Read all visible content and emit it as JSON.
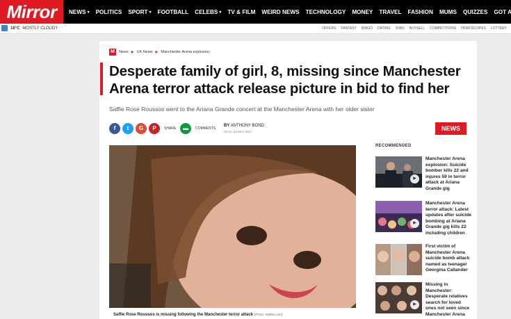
{
  "brand": {
    "logo": "Mirror",
    "accent": "#e01a22"
  },
  "nav": [
    {
      "label": "NEWS",
      "caret": "▾"
    },
    {
      "label": "POLITICS",
      "caret": ""
    },
    {
      "label": "SPORT",
      "caret": "▾"
    },
    {
      "label": "FOOTBALL",
      "caret": ""
    },
    {
      "label": "CELEBS",
      "caret": "▾"
    },
    {
      "label": "TV & FILM",
      "caret": ""
    },
    {
      "label": "WEIRD NEWS",
      "caret": ""
    },
    {
      "label": "TECHNOLOGY",
      "caret": ""
    },
    {
      "label": "MONEY",
      "caret": ""
    },
    {
      "label": "TRAVEL",
      "caret": ""
    },
    {
      "label": "FASHION",
      "caret": ""
    },
    {
      "label": "MUMS",
      "caret": ""
    },
    {
      "label": "QUIZZES",
      "caret": ""
    },
    {
      "label": "GOT A STORY?",
      "caret": ""
    }
  ],
  "weather": {
    "temp": "18°C",
    "condition": "MOSTLY CLOUDY",
    "icon": "weather-icon"
  },
  "sublinks": [
    "OFFERS",
    "FANTASY",
    "BINGO",
    "DATING",
    "JOBS",
    "BUYSELL",
    "COMPETITIONS",
    "HOROSCOPES",
    "LOTTERY"
  ],
  "breadcrumb": [
    "News",
    "UK News",
    "Manchester Arena explosion"
  ],
  "article": {
    "headline": "Desperate family of girl, 8, missing since Manchester Arena terror attack release picture in bid to find her",
    "standfirst": "Saffie Rose Roussos went to the Ariana Grande concert at the Manchester Arena with her older sister",
    "share_label": "SHARE",
    "comments_label": "COMMENTS",
    "byline_prefix": "BY",
    "author": "ANTHONY BOND",
    "date": "10:21, 23 MAY 2017",
    "section_tag": "NEWS",
    "caption": "Saffie Rose Roussos is missing following the Manchester terror attack",
    "caption_credit": "(Photo: SWNS.com)"
  },
  "recommended": {
    "heading": "RECOMMENDED",
    "items": [
      {
        "text": "Manchester Arena explosion: Suicide bomber kills 22 and injures 59 in terror attack at Ariana Grande gig",
        "video": true
      },
      {
        "text": "Manchester Arena terror attack: Latest updates after suicide bombing at Ariana Grande gig kills 22 including children",
        "video": true
      },
      {
        "text": "First victim of Manchester Arena suicide bomb attack named as teenager Georgina Callander",
        "video": false
      },
      {
        "text": "Missing in Manchester: Desperate relatives search for loved ones not seen since Manchester Arena",
        "video": true
      }
    ]
  }
}
